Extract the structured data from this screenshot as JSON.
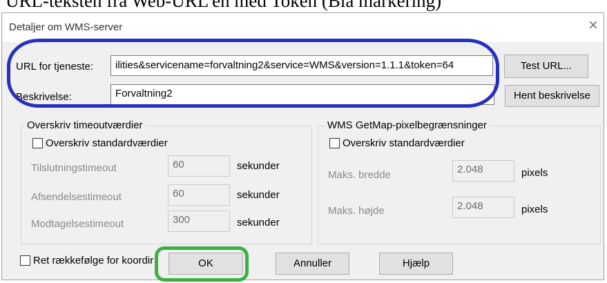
{
  "caption": "URL-teksten fra Web-URL'en med Token (Bla markering)",
  "dialog": {
    "title": "Detaljer om WMS-server",
    "close_glyph": "×",
    "url_label": "URL for tjeneste:",
    "url_value": "ilities&servicename=forvaltning2&service=WMS&version=1.1.1&token=64",
    "test_url_label": "Test URL...",
    "description_label": "Beskrivelse:",
    "description_value": "Forvaltning2",
    "fetch_description_label": "Hent beskrivelse",
    "timeout_group": {
      "legend": "Overskriv timeoutværdier",
      "override_label": "Overskriv standardværdier",
      "override_checked": false,
      "rows": [
        {
          "label": "Tilslutningstimeout",
          "value": "60",
          "unit": "sekunder"
        },
        {
          "label": "Afsendelsestimeout",
          "value": "60",
          "unit": "sekunder"
        },
        {
          "label": "Modtagelsestimeout",
          "value": "300",
          "unit": "sekunder"
        }
      ]
    },
    "pixel_group": {
      "legend": "WMS GetMap-pixelbegrænsninger",
      "override_label": "Overskriv standardværdier",
      "override_checked": false,
      "rows": [
        {
          "label": "Maks. bredde",
          "value": "2.048",
          "unit": "pixels"
        },
        {
          "label": "Maks. højde",
          "value": "2.048",
          "unit": "pixels"
        }
      ]
    },
    "order_label": "Ret rækkefølge for koordir",
    "order_checked": false,
    "ok_label": "OK",
    "cancel_label": "Annuller",
    "help_label": "Hjælp"
  },
  "annotations": {
    "blue_color": "#2630bf",
    "green_color": "#3cb043"
  }
}
